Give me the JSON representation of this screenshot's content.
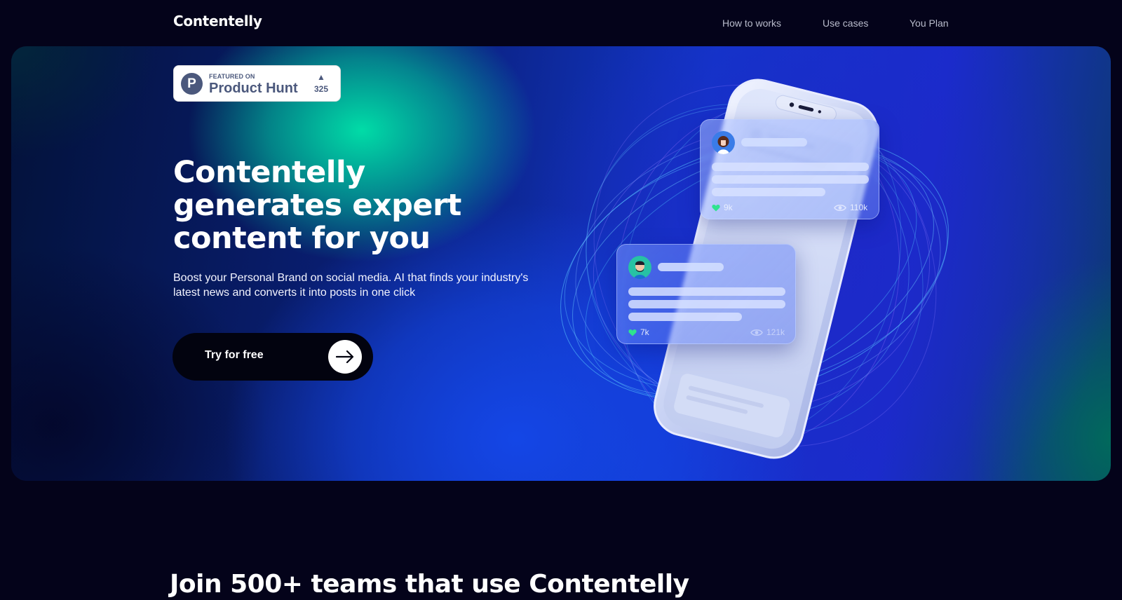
{
  "brand": {
    "name": "Contentelly"
  },
  "nav": {
    "items": [
      {
        "label": "How to works"
      },
      {
        "label": "Use cases"
      },
      {
        "label": "You Plan"
      }
    ]
  },
  "badge": {
    "small_label": "FEATURED ON",
    "name": "Product Hunt",
    "letter": "P",
    "arrow": "▲",
    "votes": "325"
  },
  "hero": {
    "headline": "Contentelly generates expert content for you",
    "subline": "Boost your Personal Brand on social media. AI that finds your industry's latest news and converts it into posts in one click",
    "cta_label": "Try for free"
  },
  "cards": [
    {
      "likes": "9k",
      "views": "110k"
    },
    {
      "likes": "7k",
      "views": "121k"
    }
  ],
  "section": {
    "teams_heading": "Join 500+ teams that use Contentelly"
  },
  "colors": {
    "background": "#04031a",
    "accent_green": "#2fe38e",
    "badge_text": "#4b587c",
    "cta_bg": "#02030f"
  },
  "icons": [
    "arrow-right-icon",
    "heart-icon",
    "eye-icon",
    "product-hunt-logo",
    "upvote-arrow-icon"
  ]
}
